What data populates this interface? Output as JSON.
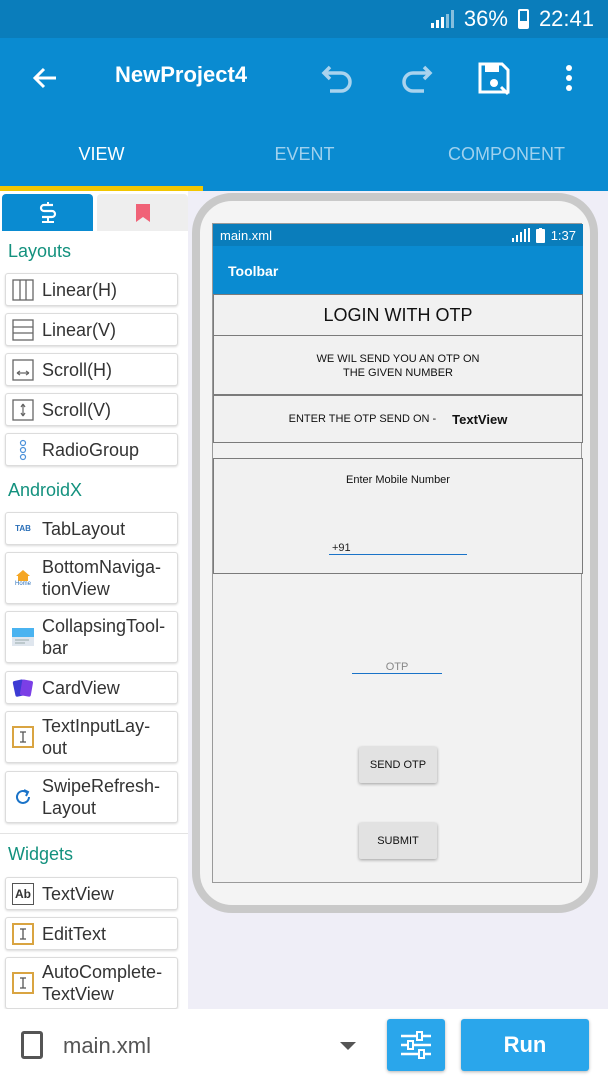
{
  "status_bar": {
    "battery": "36%",
    "time": "22:41"
  },
  "app_bar": {
    "title": "NewProject4"
  },
  "tabs": [
    {
      "label": "VIEW",
      "active": true
    },
    {
      "label": "EVENT",
      "active": false
    },
    {
      "label": "COMPONENT",
      "active": false
    }
  ],
  "palette": {
    "sections": {
      "layouts": "Layouts",
      "androidx": "AndroidX",
      "widgets": "Widgets"
    },
    "layouts": [
      {
        "label": "Linear(H)",
        "icon": "linear-h-icon"
      },
      {
        "label": "Linear(V)",
        "icon": "linear-v-icon"
      },
      {
        "label": "Scroll(H)",
        "icon": "scroll-h-icon"
      },
      {
        "label": "Scroll(V)",
        "icon": "scroll-v-icon"
      },
      {
        "label": "RadioGroup",
        "icon": "radio-group-icon"
      }
    ],
    "androidx": [
      {
        "label": "TabLayout",
        "icon": "tab-layout-icon",
        "icon_text": "TAB"
      },
      {
        "label": "BottomNaviga-\ntionView",
        "icon": "bottom-navigation-icon",
        "icon_text": "Home"
      },
      {
        "label": "CollapsingTool-\nbar",
        "icon": "collapsing-toolbar-icon"
      },
      {
        "label": "CardView",
        "icon": "card-view-icon"
      },
      {
        "label": "TextInputLay-\nout",
        "icon": "text-input-layout-icon"
      },
      {
        "label": "SwipeRefresh-\nLayout",
        "icon": "swipe-refresh-icon"
      }
    ],
    "widgets": [
      {
        "label": "TextView",
        "icon": "text-view-icon",
        "icon_text": "Ab"
      },
      {
        "label": "EditText",
        "icon": "edit-text-icon"
      },
      {
        "label": "AutoComplete-\nTextView",
        "icon": "autocomplete-icon"
      }
    ]
  },
  "preview": {
    "file": "main.xml",
    "time": "1:37",
    "toolbar": "Toolbar",
    "heading": "LOGIN WITH OTP",
    "info_line1": "WE WIL SEND YOU AN OTP ON",
    "info_line2": "THE GIVEN NUMBER",
    "otp_label": "ENTER THE OTP SEND ON -",
    "otp_value": "TextView",
    "mobile_label": "Enter Mobile Number",
    "mobile_value": "+91",
    "otp_hint": "OTP",
    "send_button": "SEND OTP",
    "submit_button": "SUBMIT"
  },
  "bottom_bar": {
    "file": "main.xml",
    "run": "Run"
  },
  "colors": {
    "primary": "#0a8bd1",
    "status": "#0a7dbb",
    "accent": "#f2c600",
    "section": "#13917e",
    "button": "#2aa6eb"
  }
}
